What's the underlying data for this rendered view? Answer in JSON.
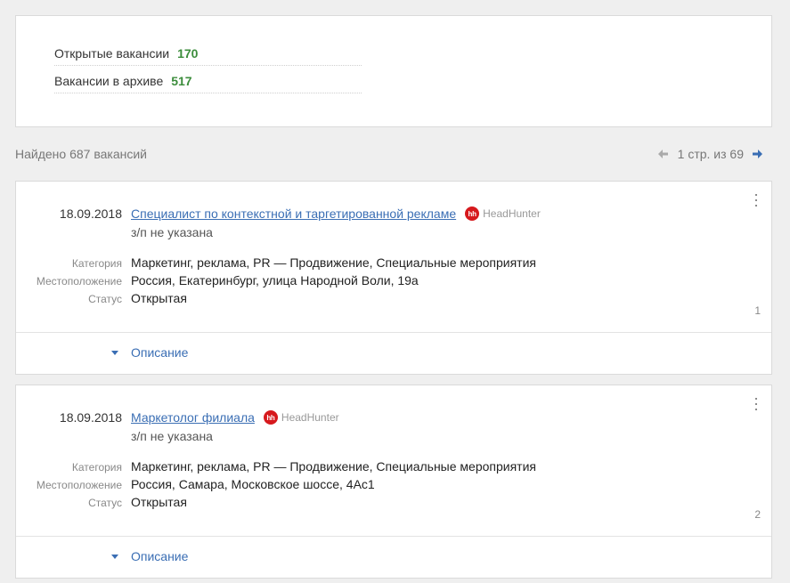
{
  "stats": {
    "open_label": "Открытые вакансии",
    "open_count": "170",
    "archive_label": "Вакансии в архиве",
    "archive_count": "517"
  },
  "results": {
    "found_text": "Найдено 687 вакансий",
    "page_text": "1 стр. из 69"
  },
  "labels": {
    "category": "Категория",
    "location": "Местоположение",
    "status": "Статус",
    "description": "Описание"
  },
  "vacancies": [
    {
      "date": "18.09.2018",
      "title": "Специалист по контекстной и таргетированной рекламе",
      "source_badge": "hh",
      "source_name": "HeadHunter",
      "salary": "з/п не указана",
      "category": "Маркетинг, реклама, PR — Продвижение, Специальные мероприятия",
      "location": "Россия, Екатеринбург, улица Народной Воли, 19а",
      "status": "Открытая",
      "index": "1"
    },
    {
      "date": "18.09.2018",
      "title": "Маркетолог филиала",
      "source_badge": "hh",
      "source_name": "HeadHunter",
      "salary": "з/п не указана",
      "category": "Маркетинг, реклама, PR — Продвижение, Специальные мероприятия",
      "location": "Россия, Самара, Московское шоссе, 4Ас1",
      "status": "Открытая",
      "index": "2"
    }
  ],
  "colors": {
    "accent": "#3a6eb4",
    "count_green": "#3c8d3c",
    "hh_red": "#d6191d"
  }
}
